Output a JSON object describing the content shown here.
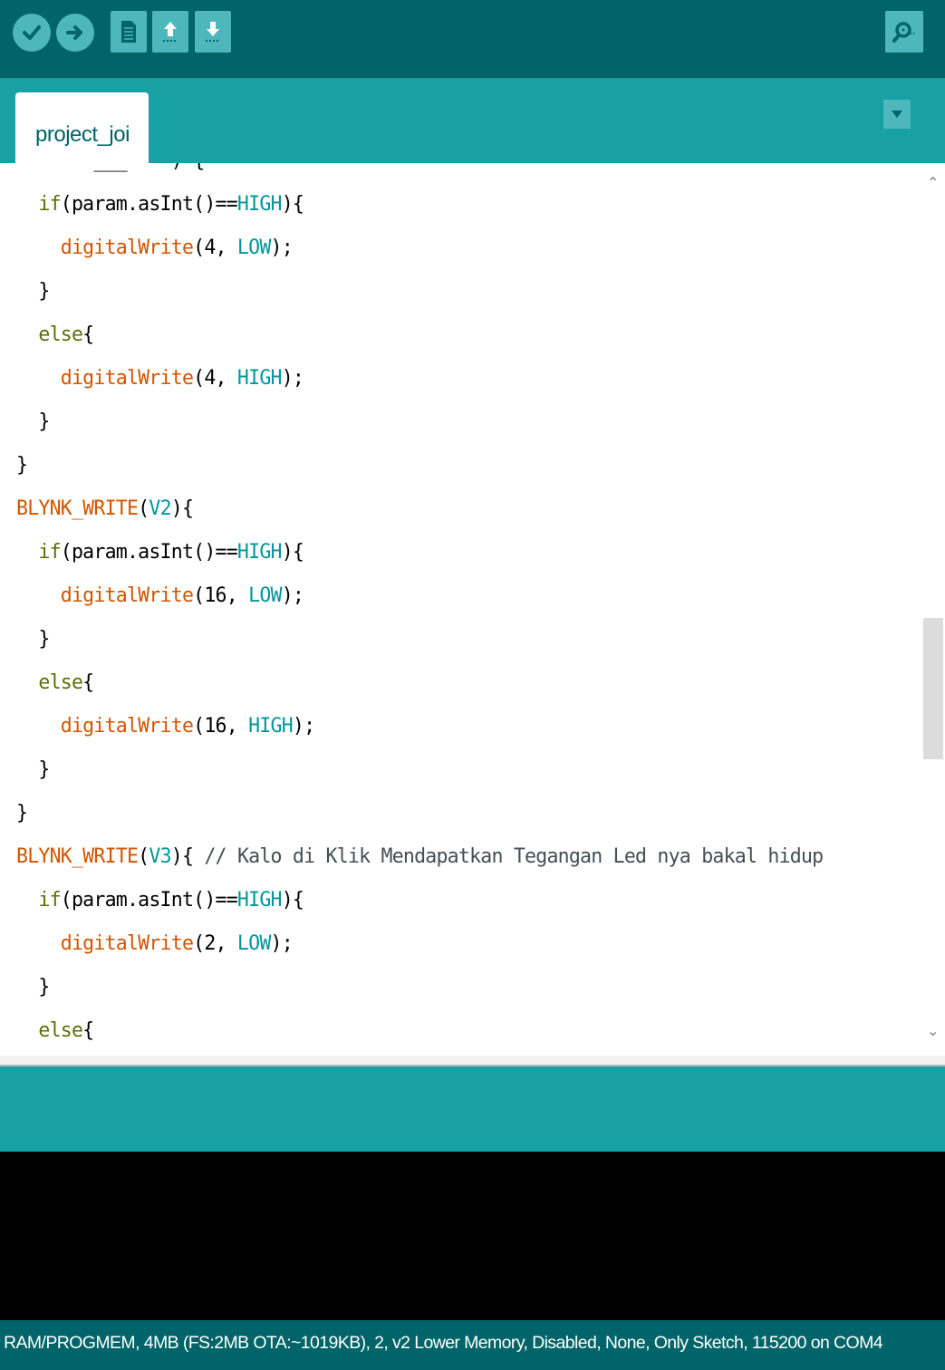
{
  "toolbar": {
    "buttons": [
      {
        "name": "verify",
        "icon": "checkmark-icon"
      },
      {
        "name": "upload",
        "icon": "arrow-right-icon"
      },
      {
        "name": "new",
        "icon": "document-icon"
      },
      {
        "name": "open",
        "icon": "arrow-up-icon"
      },
      {
        "name": "save",
        "icon": "arrow-down-icon"
      },
      {
        "name": "serial-monitor",
        "icon": "magnifier-icon"
      }
    ]
  },
  "tabs": {
    "active_label": "project_joi",
    "menu_icon": "triangle-down-icon"
  },
  "editor": {
    "lines": [
      [
        {
          "t": "  if",
          "c": "kw"
        },
        {
          "t": "(param.asInt()==",
          "c": ""
        },
        {
          "t": "HIGH",
          "c": "cst"
        },
        {
          "t": "){",
          "c": ""
        }
      ],
      [
        {
          "t": "    digitalWrite",
          "c": "fn"
        },
        {
          "t": "(4, ",
          "c": ""
        },
        {
          "t": "LOW",
          "c": "cst"
        },
        {
          "t": ");",
          "c": ""
        }
      ],
      [
        {
          "t": "  }",
          "c": ""
        }
      ],
      [
        {
          "t": "  else",
          "c": "kw"
        },
        {
          "t": "{",
          "c": ""
        }
      ],
      [
        {
          "t": "    digitalWrite",
          "c": "fn"
        },
        {
          "t": "(4, ",
          "c": ""
        },
        {
          "t": "HIGH",
          "c": "cst"
        },
        {
          "t": ");",
          "c": ""
        }
      ],
      [
        {
          "t": "  }",
          "c": ""
        }
      ],
      [
        {
          "t": "}",
          "c": ""
        }
      ],
      [
        {
          "t": "BLYNK_WRITE",
          "c": "fn"
        },
        {
          "t": "(",
          "c": ""
        },
        {
          "t": "V2",
          "c": "cst"
        },
        {
          "t": "){",
          "c": ""
        }
      ],
      [
        {
          "t": "  if",
          "c": "kw"
        },
        {
          "t": "(param.asInt()==",
          "c": ""
        },
        {
          "t": "HIGH",
          "c": "cst"
        },
        {
          "t": "){",
          "c": ""
        }
      ],
      [
        {
          "t": "    digitalWrite",
          "c": "fn"
        },
        {
          "t": "(16, ",
          "c": ""
        },
        {
          "t": "LOW",
          "c": "cst"
        },
        {
          "t": ");",
          "c": ""
        }
      ],
      [
        {
          "t": "  }",
          "c": ""
        }
      ],
      [
        {
          "t": "  else",
          "c": "kw"
        },
        {
          "t": "{",
          "c": ""
        }
      ],
      [
        {
          "t": "    digitalWrite",
          "c": "fn"
        },
        {
          "t": "(16, ",
          "c": ""
        },
        {
          "t": "HIGH",
          "c": "cst"
        },
        {
          "t": ");",
          "c": ""
        }
      ],
      [
        {
          "t": "  }",
          "c": ""
        }
      ],
      [
        {
          "t": "}",
          "c": ""
        }
      ],
      [
        {
          "t": "BLYNK_WRITE",
          "c": "fn"
        },
        {
          "t": "(",
          "c": ""
        },
        {
          "t": "V3",
          "c": "cst"
        },
        {
          "t": "){ ",
          "c": ""
        },
        {
          "t": "// Kalo di Klik Mendapatkan Tegangan Led nya bakal hidup",
          "c": "cm"
        }
      ],
      [
        {
          "t": "  if",
          "c": "kw"
        },
        {
          "t": "(param.asInt()==",
          "c": ""
        },
        {
          "t": "HIGH",
          "c": "cst"
        },
        {
          "t": "){",
          "c": ""
        }
      ],
      [
        {
          "t": "    digitalWrite",
          "c": "fn"
        },
        {
          "t": "(2, ",
          "c": ""
        },
        {
          "t": "LOW",
          "c": "cst"
        },
        {
          "t": ");",
          "c": ""
        }
      ],
      [
        {
          "t": "  }",
          "c": ""
        }
      ],
      [
        {
          "t": "  else",
          "c": "kw"
        },
        {
          "t": "{",
          "c": ""
        }
      ]
    ],
    "scroll_position": 0.55
  },
  "status": {
    "text": "RAM/PROGMEM, 4MB (FS:2MB OTA:~1019KB), 2, v2 Lower Memory, Disabled, None, Only Sketch, 115200 on COM4"
  },
  "colors": {
    "toolbar_bg": "#006468",
    "tab_bar_bg": "#17a1a5",
    "button_bg": "#4db7bb",
    "keyword": "#5e6d03",
    "function": "#d35400",
    "constant": "#00979c"
  }
}
